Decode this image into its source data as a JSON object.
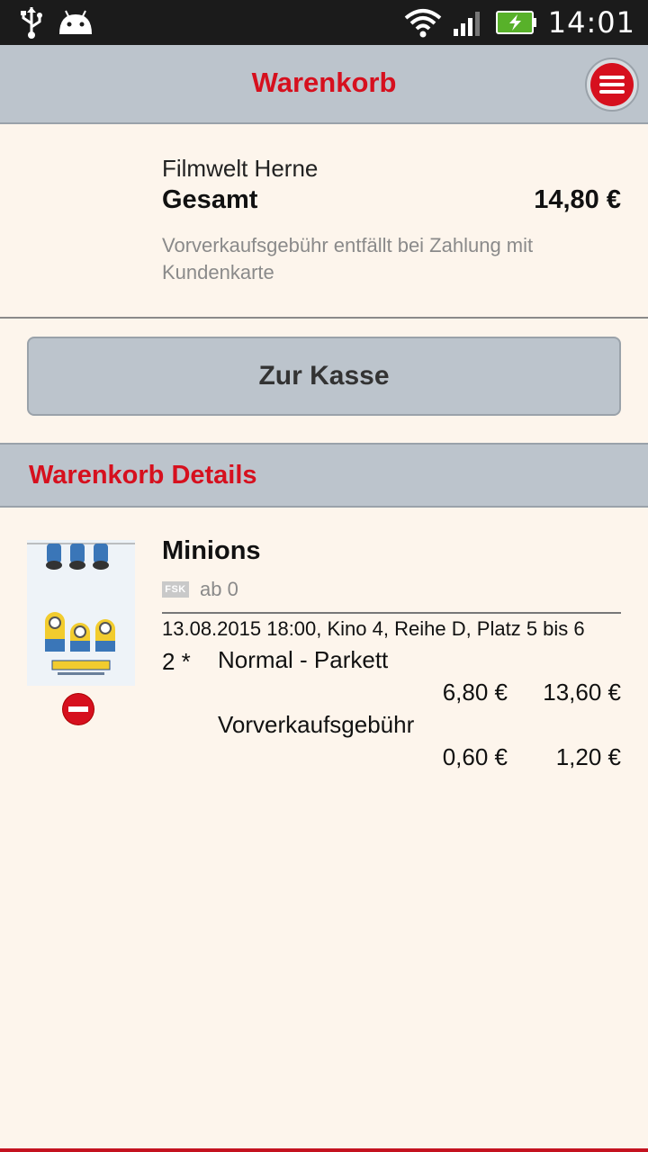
{
  "status_bar": {
    "time": "14:01"
  },
  "app_bar": {
    "title": "Warenkorb"
  },
  "summary": {
    "cinema": "Filmwelt Herne",
    "total_label": "Gesamt",
    "total_value": "14,80 €",
    "note": "Vorverkaufsgebühr entfällt bei Zahlung mit Kundenkarte"
  },
  "checkout_button": {
    "label": "Zur Kasse"
  },
  "details_header": {
    "title": "Warenkorb Details"
  },
  "item": {
    "title": "Minions",
    "fsk_badge": "FSK",
    "fsk_rating": "ab 0",
    "showtime": "13.08.2015 18:00, Kino 4, Reihe D, Platz 5 bis 6",
    "quantity": "2 *",
    "lines": [
      {
        "label": "Normal - Parkett",
        "unit_price": "6,80 €",
        "total": "13,60 €"
      },
      {
        "label": "Vorverkaufsgebühr",
        "unit_price": "0,60 €",
        "total": "1,20 €"
      }
    ]
  },
  "colors": {
    "accent": "#d6101e",
    "bar_bg": "#bcc4cc",
    "page_bg": "#fdf5ec"
  }
}
